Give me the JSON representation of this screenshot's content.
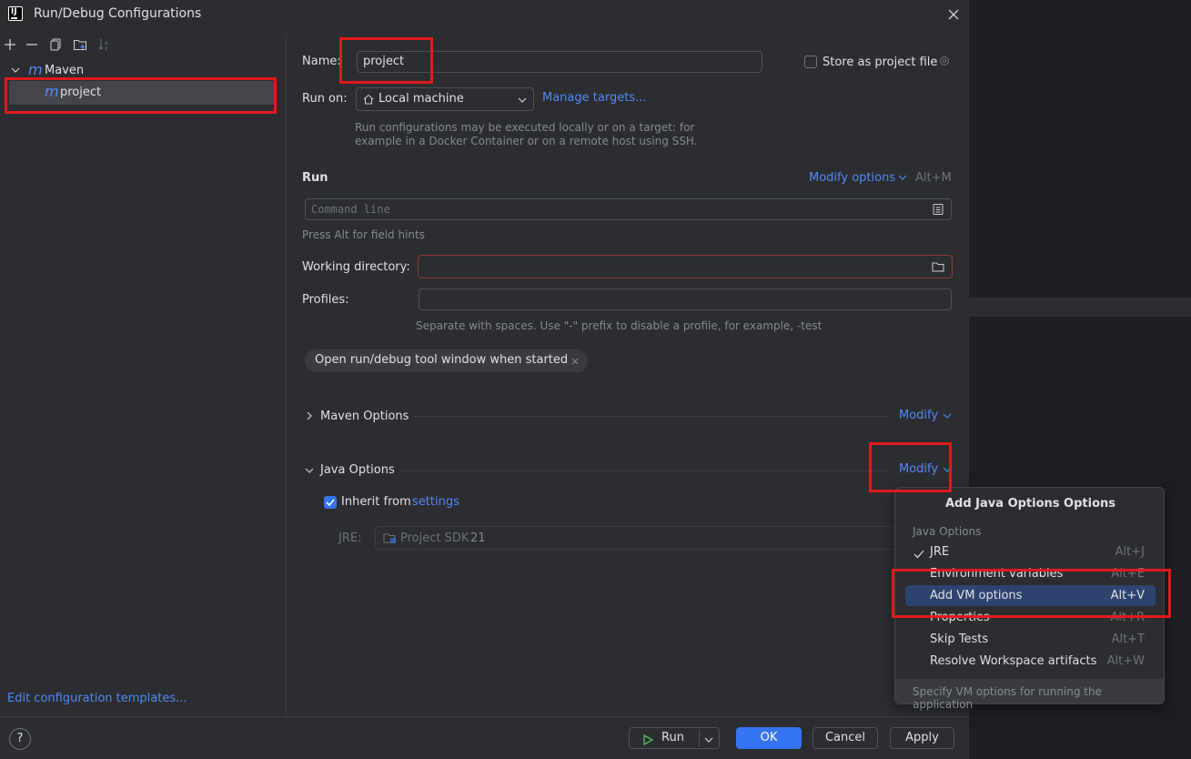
{
  "window": {
    "title": "Run/Debug Configurations"
  },
  "toolbar": {
    "add": "+",
    "remove": "—",
    "copy": "copy",
    "folder": "folder",
    "sort": "sort"
  },
  "tree": {
    "group_label": "Maven",
    "item_label": "project",
    "maven_glyph": "m"
  },
  "left_footer": {
    "edit_templates": "Edit configuration templates..."
  },
  "form": {
    "name_label": "Name:",
    "name_value": "project",
    "store_label": "Store as project file",
    "run_on_label": "Run on:",
    "run_on_value": "Local machine",
    "manage_targets": "Manage targets...",
    "run_on_hint_1": "Run configurations may be executed locally or on a target: for",
    "run_on_hint_2": "example in a Docker Container or on a remote host using SSH.",
    "run_section": "Run",
    "modify_options": "Modify options",
    "modify_options_shortcut": "Alt+M",
    "command_line_placeholder": "Command line",
    "field_hint": "Press Alt for field hints",
    "working_dir_label": "Working directory:",
    "working_dir_value": "",
    "profiles_label": "Profiles:",
    "profiles_value": "",
    "profiles_hint": "Separate with spaces. Use \"-\" prefix to disable a profile, for example, -test",
    "tag_open_tool_window": "Open run/debug tool window when started",
    "maven_options": "Maven Options",
    "java_options": "Java Options",
    "modify": "Modify",
    "inherit_label": "Inherit from",
    "inherit_link": "settings",
    "inherit_checked": true,
    "jre_label": "JRE:",
    "jre_value": "Project SDK",
    "jre_version": "21"
  },
  "popup": {
    "title": "Add Java Options Options",
    "group": "Java Options",
    "items": [
      {
        "label": "JRE",
        "shortcut": "Alt+J",
        "checked": true
      },
      {
        "label": "Environment variables",
        "shortcut": "Alt+E"
      },
      {
        "label": "Add VM options",
        "shortcut": "Alt+V",
        "selected": true
      },
      {
        "label": "Properties",
        "shortcut": "Alt+R"
      },
      {
        "label": "Skip Tests",
        "shortcut": "Alt+T"
      },
      {
        "label": "Resolve Workspace artifacts",
        "shortcut": "Alt+W"
      }
    ],
    "footer": "Specify VM options for running the application"
  },
  "footer": {
    "help": "?",
    "run": "Run",
    "ok": "OK",
    "cancel": "Cancel",
    "apply": "Apply"
  },
  "colors": {
    "accent": "#3574f0",
    "link": "#548af7",
    "annotation": "#e01b1b"
  }
}
